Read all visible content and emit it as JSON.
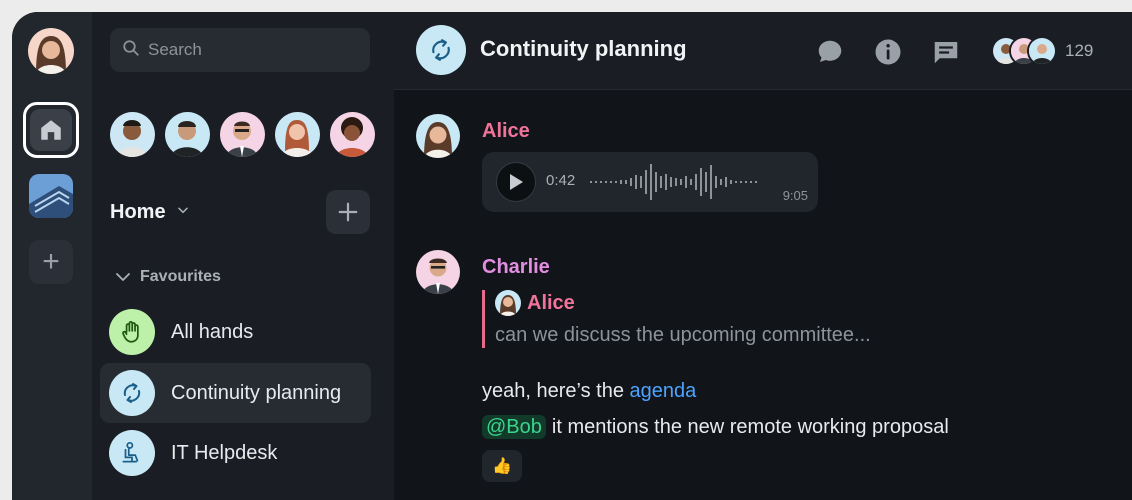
{
  "search": {
    "placeholder": "Search"
  },
  "rooms_header": {
    "label": "Home"
  },
  "favourites": {
    "label": "Favourites"
  },
  "rooms": [
    {
      "name": "All hands",
      "icon": "raised-hand-icon",
      "color": "#bdf0a8"
    },
    {
      "name": "Continuity planning",
      "icon": "sync-icon",
      "color": "#c9e8f5",
      "active": true
    },
    {
      "name": "IT Helpdesk",
      "icon": "chair-person-icon",
      "color": "#c9e8f5"
    }
  ],
  "room": {
    "title": "Continuity planning",
    "member_count": "129"
  },
  "messages": {
    "alice": {
      "sender": "Alice",
      "sender_color": "#f0739a",
      "voice": {
        "elapsed": "0:42",
        "duration": "9:05"
      }
    },
    "charlie": {
      "sender": "Charlie",
      "sender_color": "#e28ee0",
      "reply": {
        "sender": "Alice",
        "text": "can we discuss the upcoming committee..."
      },
      "line1": {
        "text": "yeah, here’s the ",
        "link": "agenda"
      },
      "line2": {
        "mention": "@Bob",
        "text": "it mentions the new remote working proposal"
      },
      "reaction": "👍"
    }
  }
}
